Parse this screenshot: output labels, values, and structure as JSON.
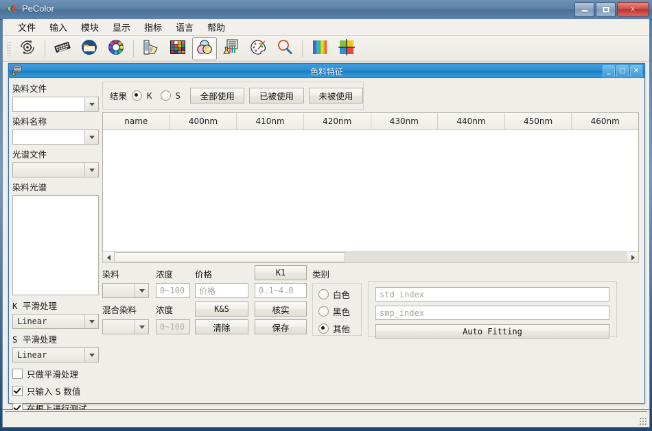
{
  "window": {
    "title": "PeColor",
    "app_icon": "pecolor-logo-icon",
    "minimize": "–",
    "maximize": "□",
    "close": "x"
  },
  "menubar": {
    "items": [
      {
        "label": "文件",
        "name": "menu-file"
      },
      {
        "label": "输入",
        "name": "menu-input"
      },
      {
        "label": "模块",
        "name": "menu-module"
      },
      {
        "label": "显示",
        "name": "menu-display"
      },
      {
        "label": "指标",
        "name": "menu-index"
      },
      {
        "label": "语言",
        "name": "menu-language"
      },
      {
        "label": "帮助",
        "name": "menu-help"
      }
    ]
  },
  "toolbar": {
    "buttons": [
      {
        "icon": "gear-refresh-icon",
        "active": false
      },
      {
        "sep": true
      },
      {
        "icon": "keyboard-icon",
        "active": false
      },
      {
        "icon": "folder-open-icon",
        "active": false
      },
      {
        "icon": "color-wheel-icon",
        "active": false
      },
      {
        "sep": true
      },
      {
        "icon": "color-fan-swatch-icon",
        "active": false
      },
      {
        "icon": "color-grid-icon",
        "active": false
      },
      {
        "icon": "venn-circles-icon",
        "active": true
      },
      {
        "icon": "lab-equipment-icon",
        "active": false
      },
      {
        "icon": "artist-palette-icon",
        "active": false
      },
      {
        "icon": "magnifier-icon",
        "active": false
      },
      {
        "sep": true
      },
      {
        "icon": "rainbow-gradient-icon",
        "active": false
      },
      {
        "icon": "color-quadrant-icon",
        "active": false
      }
    ]
  },
  "mdi": {
    "title": "色料特征",
    "icon": "lab-equipment-icon",
    "minimize": "_",
    "maximize": "□",
    "close": "✕"
  },
  "sidebar": {
    "dye_file_label": "染料文件",
    "dye_file_value": "",
    "dye_name_label": "染料名称",
    "dye_name_value": "",
    "spectrum_file_label": "光谱文件",
    "spectrum_file_value": "",
    "dye_spectrum_label": "染料光谱",
    "k_smooth_label": "K 平滑处理",
    "k_smooth_value": "Linear",
    "s_smooth_label": "S 平滑处理",
    "s_smooth_value": "Linear",
    "checkboxes": [
      {
        "label": "只做平滑处理",
        "checked": false,
        "name": "checkbox-smooth-only"
      },
      {
        "label": "只输入 S 数值",
        "checked": true,
        "name": "checkbox-input-s-only"
      },
      {
        "label": "在根上进行测试",
        "checked": true,
        "name": "checkbox-test-on-root"
      }
    ]
  },
  "result_bar": {
    "label": "结果",
    "radios": [
      {
        "label": "K",
        "checked": true,
        "name": "radio-result-k"
      },
      {
        "label": "S",
        "checked": false,
        "name": "radio-result-s"
      }
    ],
    "buttons": [
      {
        "label": "全部使用",
        "name": "use-all-button"
      },
      {
        "label": "已被使用",
        "name": "used-button"
      },
      {
        "label": "未被使用",
        "name": "unused-button"
      }
    ]
  },
  "table": {
    "columns": [
      "name",
      "400nm",
      "410nm",
      "420nm",
      "430nm",
      "440nm",
      "450nm",
      "460nm"
    ],
    "rows": [],
    "hscroll_thumb_percent": 45
  },
  "bottom": {
    "dye_label": "染料",
    "dye_value": "",
    "concentration_label": "浓度",
    "concentration_placeholder": "0~100",
    "price_label": "价格",
    "price_placeholder": "价格",
    "k1_button": "K1",
    "k1_range_placeholder": "0.1~4.0",
    "mixed_dye_label": "混合染料",
    "mixed_dye_value": "",
    "mixed_concentration_label": "浓度",
    "mixed_concentration_placeholder": "0~100",
    "ks_button": "K&S",
    "verify_button": "核实",
    "clear_button": "清除",
    "save_button": "保存",
    "category_label": "类别",
    "categories": [
      {
        "label": "白色",
        "checked": false,
        "name": "radio-category-white"
      },
      {
        "label": "黑色",
        "checked": false,
        "name": "radio-category-black"
      },
      {
        "label": "其他",
        "checked": true,
        "name": "radio-category-other"
      }
    ],
    "std_index_placeholder": "std_index",
    "std_index_value": "",
    "smp_index_placeholder": "smp_index",
    "smp_index_value": "",
    "auto_fitting_button": "Auto Fitting"
  },
  "colors": {
    "title_blue": "#4b7099",
    "mdi_blue": "#2f8fd4",
    "panel_bg": "#efeee8",
    "close_red": "#cf4b43"
  }
}
